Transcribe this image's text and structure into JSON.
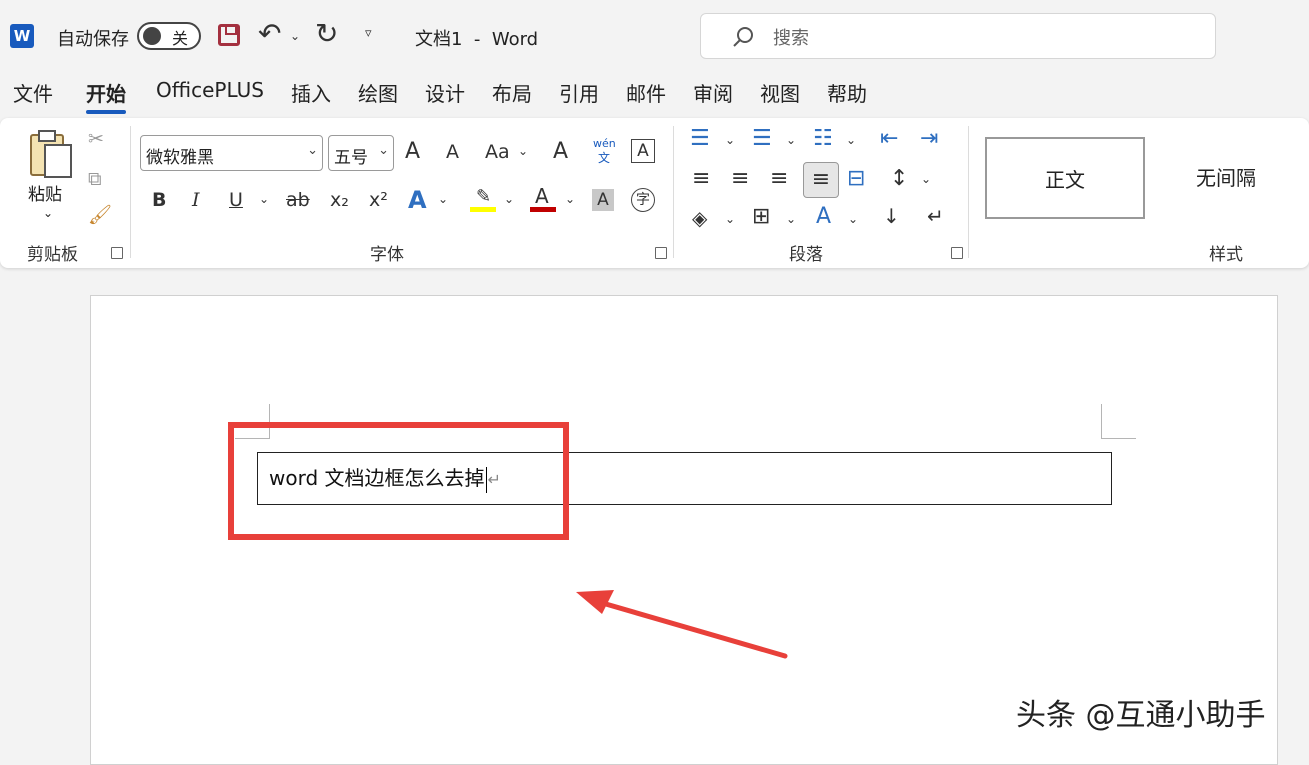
{
  "titlebar": {
    "autosave_label": "自动保存",
    "autosave_state": "关",
    "doc_title": "文档1  -  Word",
    "search_placeholder": "搜索"
  },
  "tabs": [
    "文件",
    "开始",
    "OfficePLUS",
    "插入",
    "绘图",
    "设计",
    "布局",
    "引用",
    "邮件",
    "审阅",
    "视图",
    "帮助"
  ],
  "active_tab": "开始",
  "ribbon": {
    "clipboard": {
      "paste_label": "粘贴",
      "group_label": "剪贴板"
    },
    "font": {
      "font_name": "微软雅黑",
      "font_size": "五号",
      "group_label": "字体",
      "bold": "B",
      "italic": "I",
      "underline": "U",
      "strike": "ab",
      "subscript": "x₂",
      "superscript": "x²",
      "case": "Aa",
      "grow": "A",
      "shrink": "A",
      "phonetic_top": "wén",
      "phonetic_bottom": "文",
      "font_color_hex": "#c00000",
      "highlight_hex": "#ffff00"
    },
    "paragraph": {
      "group_label": "段落"
    },
    "styles": {
      "group_label": "样式",
      "items": [
        "正文",
        "无间隔"
      ]
    }
  },
  "document": {
    "text": "word 文档边框怎么去掉",
    "paragraph_mark": "↵"
  },
  "watermark": "头条 @互通小助手",
  "colors": {
    "accent": "#185abd",
    "highlight_red": "#e8403a"
  }
}
